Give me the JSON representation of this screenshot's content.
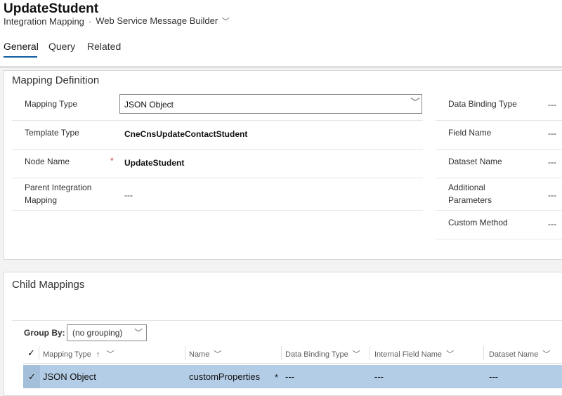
{
  "header": {
    "title": "UpdateStudent",
    "entity": "Integration Mapping",
    "separator": "·",
    "form_name": "Web Service Message Builder",
    "tabs": [
      "General",
      "Query",
      "Related"
    ]
  },
  "mapping_definition": {
    "title": "Mapping Definition",
    "mapping_type": {
      "label": "Mapping Type",
      "value": "JSON Object"
    },
    "template_type": {
      "label": "Template Type",
      "value": "CneCnsUpdateContactStudent"
    },
    "node_name": {
      "label": "Node Name",
      "required_marker": "*",
      "value": "UpdateStudent"
    },
    "parent_mapping": {
      "label_line1": "Parent Integration",
      "label_line2": "Mapping",
      "value": "---"
    },
    "right_fields": [
      {
        "label": "Data Binding Type",
        "value": "---"
      },
      {
        "label": "Field Name",
        "value": "---"
      },
      {
        "label": "Dataset Name",
        "value": "---"
      },
      {
        "label_line1": "Additional",
        "label_line2": "Parameters",
        "value": "---"
      },
      {
        "label": "Custom Method",
        "value": "---"
      }
    ]
  },
  "child_mappings": {
    "title": "Child Mappings",
    "group_by_label": "Group By:",
    "group_by_value": "(no grouping)",
    "columns": [
      {
        "label": "Mapping Type",
        "sort": "↑"
      },
      {
        "label": "Name"
      },
      {
        "label": "Data Binding Type"
      },
      {
        "label": "Internal Field Name"
      },
      {
        "label": "Dataset Name"
      }
    ],
    "rows": [
      {
        "mapping_type": "JSON Object",
        "name": "customProperties",
        "required_marker": "*",
        "data_binding_type": "---",
        "internal_field_name": "---",
        "dataset_name": "---"
      }
    ]
  },
  "colors": {
    "accent": "#115ea3",
    "selected_row": "#b3cde6",
    "required": "#d13438"
  }
}
